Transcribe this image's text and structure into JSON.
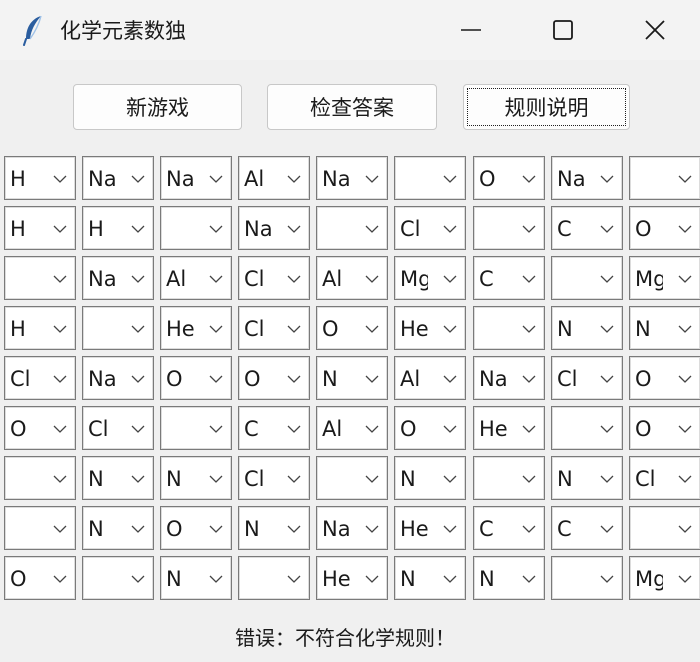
{
  "window": {
    "title": "化学元素数独",
    "app_icon": "feather-icon",
    "controls": [
      "minimize-icon",
      "maximize-icon",
      "close-icon"
    ]
  },
  "toolbar": {
    "new_game": "新游戏",
    "check_answer": "检查答案",
    "rules": "规则说明"
  },
  "grid": {
    "rows": [
      [
        "H",
        "Na",
        "Na",
        "Al",
        "Na",
        "",
        "O",
        "Na",
        ""
      ],
      [
        "H",
        "H",
        "",
        "Na",
        "",
        "Cl",
        "",
        "C",
        "O"
      ],
      [
        "",
        "Na",
        "Al",
        "Cl",
        "Al",
        "Mg",
        "C",
        "",
        "Mg"
      ],
      [
        "H",
        "",
        "He",
        "Cl",
        "O",
        "He",
        "",
        "N",
        "N"
      ],
      [
        "Cl",
        "Na",
        "O",
        "O",
        "N",
        "Al",
        "Na",
        "Cl",
        "O"
      ],
      [
        "O",
        "Cl",
        "",
        "C",
        "Al",
        "O",
        "He",
        "",
        "O"
      ],
      [
        "",
        "N",
        "N",
        "Cl",
        "",
        "N",
        "",
        "N",
        "Cl"
      ],
      [
        "",
        "N",
        "O",
        "N",
        "Na",
        "He",
        "C",
        "C",
        ""
      ],
      [
        "O",
        "",
        "N",
        "",
        "He",
        "N",
        "N",
        "",
        "Mg"
      ]
    ]
  },
  "status": {
    "message": "错误：不符合化学规则！"
  }
}
